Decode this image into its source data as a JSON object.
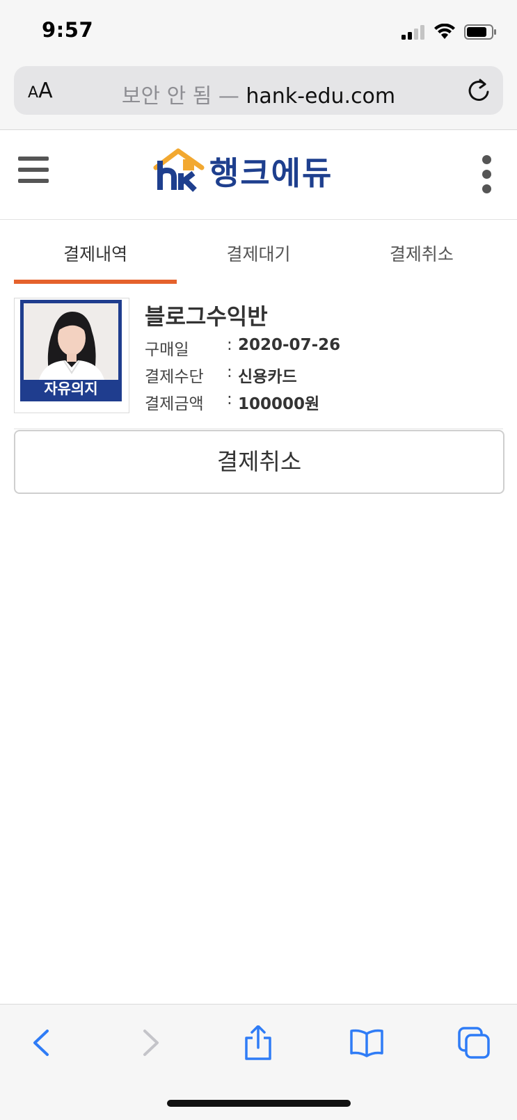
{
  "status_bar": {
    "time": "9:57"
  },
  "browser": {
    "aa_small": "A",
    "aa_large": "A",
    "security_label": "보안 안 됨 —",
    "domain": "hank-edu.com"
  },
  "header": {
    "logo_text": "행크에듀"
  },
  "tabs": [
    {
      "label": "결제내역",
      "active": true
    },
    {
      "label": "결제대기",
      "active": false
    },
    {
      "label": "결제취소",
      "active": false
    }
  ],
  "order": {
    "thumbnail_caption": "자유의지",
    "title": "블로그수익반",
    "rows": [
      {
        "label": "구매일",
        "sep": ":",
        "value": "2020-07-26"
      },
      {
        "label": "결제수단",
        "sep": ":",
        "value": "신용카드"
      },
      {
        "label": "결제금액",
        "sep": ":",
        "value": "100000원"
      }
    ],
    "cancel_label": "결제취소"
  },
  "colors": {
    "accent": "#e5622c",
    "brand": "#1e3f8e",
    "ios_blue": "#2f7cf6"
  }
}
